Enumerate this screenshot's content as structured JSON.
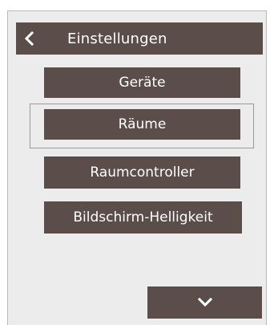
{
  "header": {
    "back_icon": "chevron-left-icon",
    "title": "Einstellungen"
  },
  "menu": {
    "items": [
      {
        "label": "Geräte"
      },
      {
        "label": "Räume",
        "selected": true
      },
      {
        "label": "Raumcontroller"
      },
      {
        "label": "Bildschirm-Helligkeit"
      }
    ]
  },
  "footer": {
    "scroll_icon": "chevron-down-icon"
  },
  "colors": {
    "button_bg": "#5a4d4a",
    "panel_bg": "#ececed",
    "text": "#ffffff"
  }
}
